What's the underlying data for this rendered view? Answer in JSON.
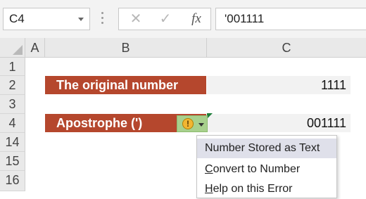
{
  "formula_bar": {
    "name_box": "C4",
    "cancel_glyph": "✕",
    "enter_glyph": "✓",
    "fx_label": "fx",
    "formula_text": "'001111"
  },
  "columns": [
    "A",
    "B",
    "C"
  ],
  "rows": [
    "1",
    "2",
    "3",
    "4",
    "14",
    "15",
    "16"
  ],
  "cells": {
    "b2": "The original number",
    "c2": "1111",
    "b4": "Apostrophe (')",
    "c4": "001111"
  },
  "error_tag": {
    "symbol": "!"
  },
  "context_menu": {
    "items": [
      "Number Stored as Text",
      "Convert to Number",
      "Help on this Error"
    ]
  },
  "colors": {
    "header_fill": "#b5472d",
    "value_fill": "#f2f2f2",
    "error_tag": "#a8d08d",
    "error_indicator": "#1e7e3a"
  }
}
